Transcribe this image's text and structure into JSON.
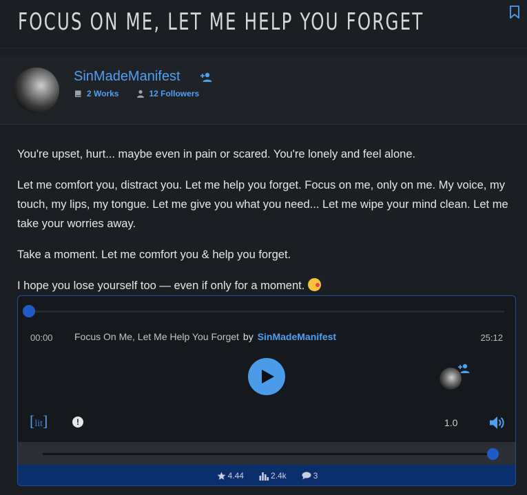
{
  "page": {
    "title": "FOCUS ON ME, LET ME HELP YOU FORGET"
  },
  "author": {
    "name": "SinMadeManifest",
    "works": "2 Works",
    "followers": "12 Followers"
  },
  "story": {
    "paragraphs": [
      "You're upset, hurt... maybe even in pain or scared. You're lonely and feel alone.",
      "Let me comfort you, distract you. Let me help you forget. Focus on me, only on me. My voice, my touch, my lips, my tongue. Let me give you what you need... Let me wipe your mind clean. Let me take your worries away.",
      "Take a moment. Let me comfort you & help you forget.",
      "I hope you lose yourself too — even if only for a moment."
    ],
    "emoji": "kiss-emoji"
  },
  "player": {
    "current_time": "00:00",
    "track_title": "Focus On Me, Let Me Help You Forget",
    "by_label": "by",
    "artist": "SinMadeManifest",
    "total_time": "25:12",
    "speed": "1.0",
    "progress": 0,
    "volume": 1.0,
    "logo_text": "lit"
  },
  "stats": {
    "rating": "4.44",
    "listens": "2.4k",
    "comments": "3"
  },
  "colors": {
    "accent": "#4fa0f0",
    "background": "#1b1e23",
    "player_border": "#1d4fa3",
    "footer": "#0b2f6d"
  }
}
